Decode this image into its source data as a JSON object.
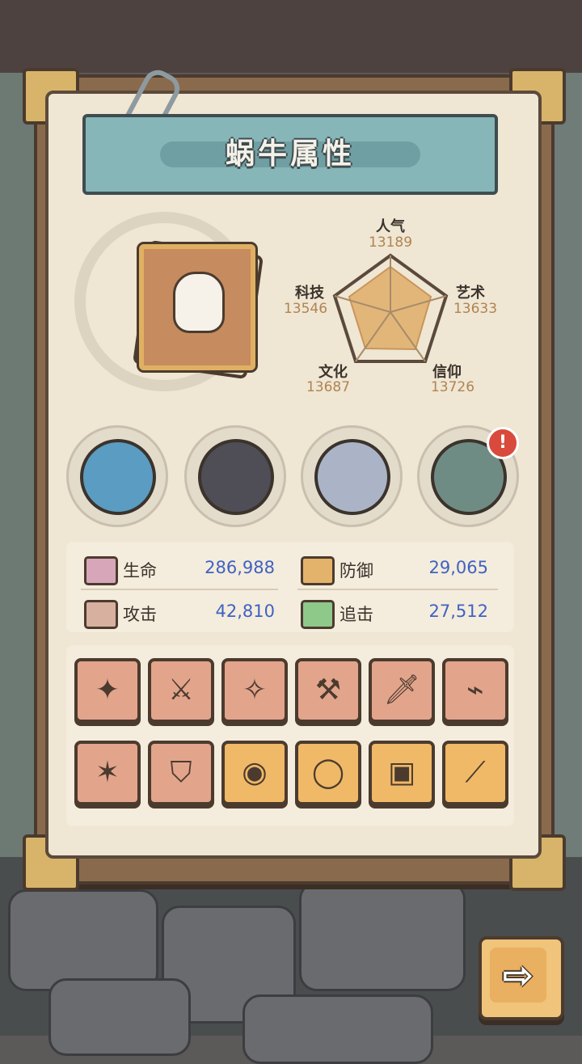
{
  "title": "蜗牛属性",
  "radar": {
    "stats": [
      {
        "key": "popularity",
        "label": "人气",
        "value": "13189"
      },
      {
        "key": "art",
        "label": "艺术",
        "value": "13633"
      },
      {
        "key": "faith",
        "label": "信仰",
        "value": "13726"
      },
      {
        "key": "culture",
        "label": "文化",
        "value": "13687"
      },
      {
        "key": "tech",
        "label": "科技",
        "value": "13546"
      }
    ]
  },
  "slots": [
    {
      "icon": "dragon-relic-icon"
    },
    {
      "icon": "dark-shell-icon"
    },
    {
      "icon": "compass-icon"
    },
    {
      "icon": "portal-orb-icon",
      "badge": "!"
    }
  ],
  "attributes": [
    {
      "icon": "health-icon",
      "label": "生命",
      "value": "286,988"
    },
    {
      "icon": "defense-icon",
      "label": "防御",
      "value": "29,065"
    },
    {
      "icon": "attack-icon",
      "label": "攻击",
      "value": "42,810"
    },
    {
      "icon": "pursuit-icon",
      "label": "追击",
      "value": "27,512"
    }
  ],
  "equipment": [
    {
      "icon": "skull-mace-icon",
      "glyph": "✦"
    },
    {
      "icon": "crystal-blade-icon",
      "glyph": "⚔"
    },
    {
      "icon": "slingshot-icon",
      "glyph": "✧"
    },
    {
      "icon": "war-hammer-icon",
      "glyph": "⚒"
    },
    {
      "icon": "sword-icon",
      "glyph": "🗡"
    },
    {
      "icon": "blaster-icon",
      "glyph": "⌁"
    },
    {
      "icon": "spear-icon",
      "glyph": "✶"
    },
    {
      "icon": "golden-helmet-icon",
      "glyph": "⛉"
    },
    {
      "icon": "goggles-icon",
      "glyph": "◉"
    },
    {
      "icon": "ring-icon",
      "glyph": "◯"
    },
    {
      "icon": "vest-armor-icon",
      "glyph": "▣"
    },
    {
      "icon": "dagger-icon",
      "glyph": "⟋"
    }
  ],
  "next_button": {
    "glyph": "⇨"
  },
  "colors": {
    "attr_value": "#3f62c3",
    "radar_fill": "#e2b679",
    "stat_value": "#b08452"
  }
}
